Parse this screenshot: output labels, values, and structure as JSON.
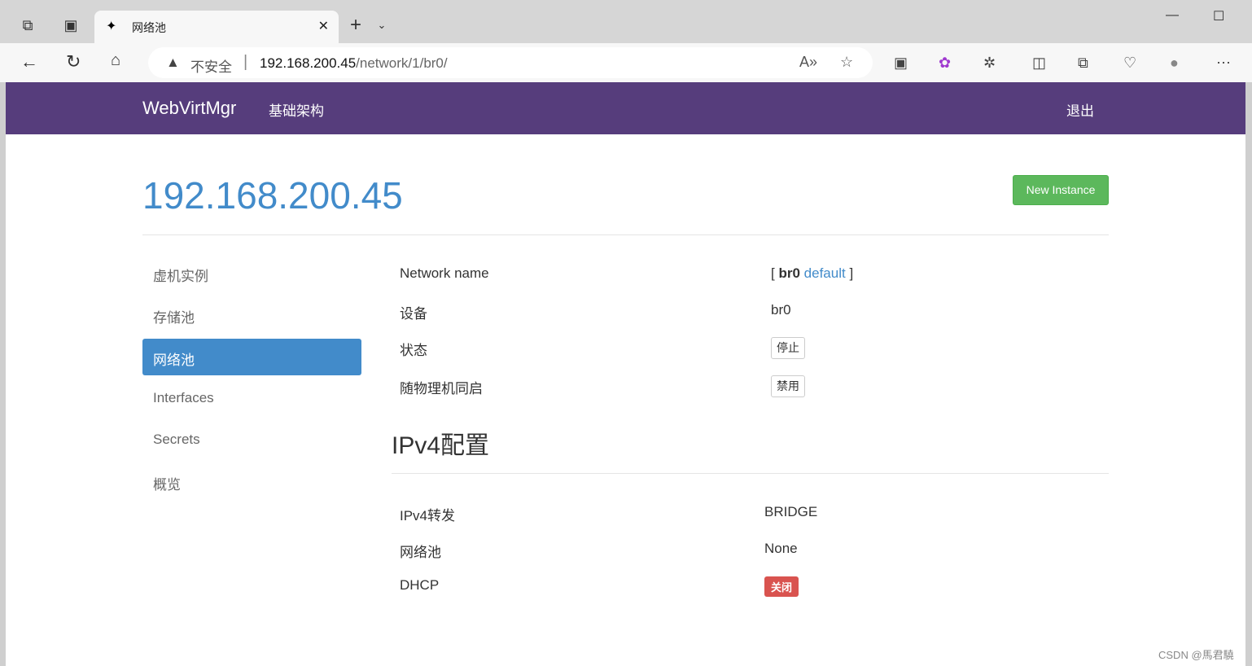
{
  "browser": {
    "tab_title": "网络池",
    "security_label": "不安全",
    "url_host": "192.168.200.45",
    "url_path": "/network/1/br0/"
  },
  "navbar": {
    "brand": "WebVirtMgr",
    "link": "基础架构",
    "logout": "退出"
  },
  "header": {
    "title": "192.168.200.45",
    "new_instance": "New Instance"
  },
  "sidebar": {
    "items": [
      {
        "label": "虚机实例"
      },
      {
        "label": "存储池"
      },
      {
        "label": "网络池",
        "active": true
      },
      {
        "label": "Interfaces"
      },
      {
        "label": "Secrets"
      },
      {
        "label": "概览"
      }
    ]
  },
  "details": {
    "network_name_label": "Network name",
    "network_name_open": "[",
    "network_name": "br0",
    "network_default": "default",
    "network_name_close": "]",
    "device_label": "设备",
    "device": "br0",
    "state_label": "状态",
    "state_button": "停止",
    "autostart_label": "随物理机同启",
    "autostart_button": "禁用"
  },
  "ipv4": {
    "title": "IPv4配置",
    "forward_label": "IPv4转发",
    "forward": "BRIDGE",
    "pool_label": "网络池",
    "pool": "None",
    "dhcp_label": "DHCP",
    "dhcp": "关闭"
  },
  "watermark": "CSDN @馬君驍"
}
